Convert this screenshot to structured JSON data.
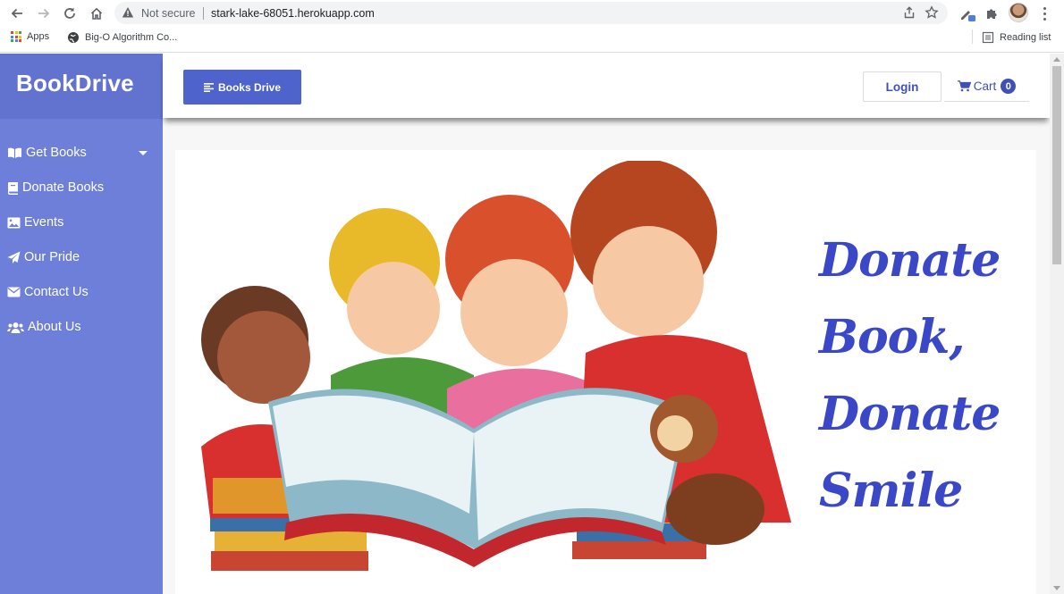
{
  "browser": {
    "security_label": "Not secure",
    "url": "stark-lake-68051.herokuapp.com",
    "bookmarks": [
      {
        "label": "Apps",
        "icon": "apps-grid-icon"
      },
      {
        "label": "Big-O Algorithm Co...",
        "icon": "globe-icon"
      }
    ],
    "reading_list": "Reading list"
  },
  "sidebar": {
    "brand": "BookDrive",
    "items": [
      {
        "label": "Get Books",
        "icon": "book-open-icon"
      },
      {
        "label": "Donate Books",
        "icon": "book-icon"
      },
      {
        "label": "Events",
        "icon": "image-icon"
      },
      {
        "label": "Our Pride",
        "icon": "paper-plane-icon"
      },
      {
        "label": "Contact Us",
        "icon": "envelope-icon"
      },
      {
        "label": "About Us",
        "icon": "users-icon"
      }
    ]
  },
  "topbar": {
    "toggle_label": "Books Drive",
    "login_label": "Login",
    "cart_label": "Cart",
    "cart_count": "0"
  },
  "hero": {
    "lines": [
      "Donate",
      "Book,",
      "Donate",
      "Smile"
    ]
  },
  "colors": {
    "sidebar": "#6d7fd8",
    "brand_box": "#6272cf",
    "primary": "#4f63cc",
    "link": "#3f51b5",
    "hero_text": "#3a48c8"
  }
}
